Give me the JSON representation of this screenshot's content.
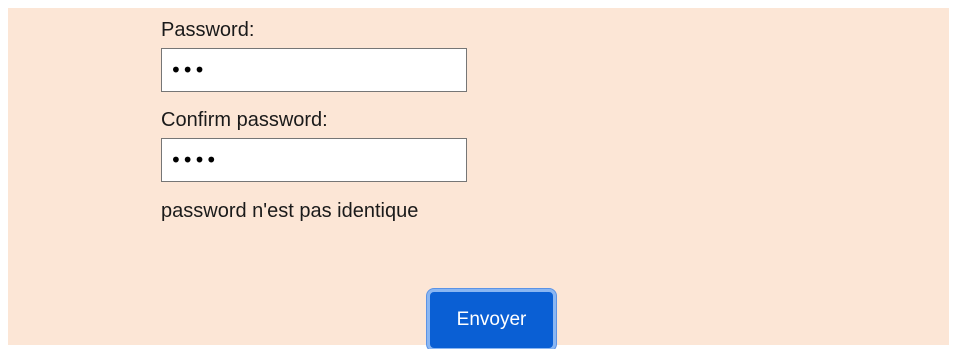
{
  "form": {
    "password_label": "Password:",
    "password_value": "abc",
    "confirm_label": "Confirm password:",
    "confirm_value": "abcd",
    "error_message": "password n'est pas identique",
    "submit_label": "Envoyer"
  },
  "colors": {
    "panel_background": "#fce6d6",
    "button_background": "#0a5fd4",
    "button_text": "#ffffff"
  }
}
